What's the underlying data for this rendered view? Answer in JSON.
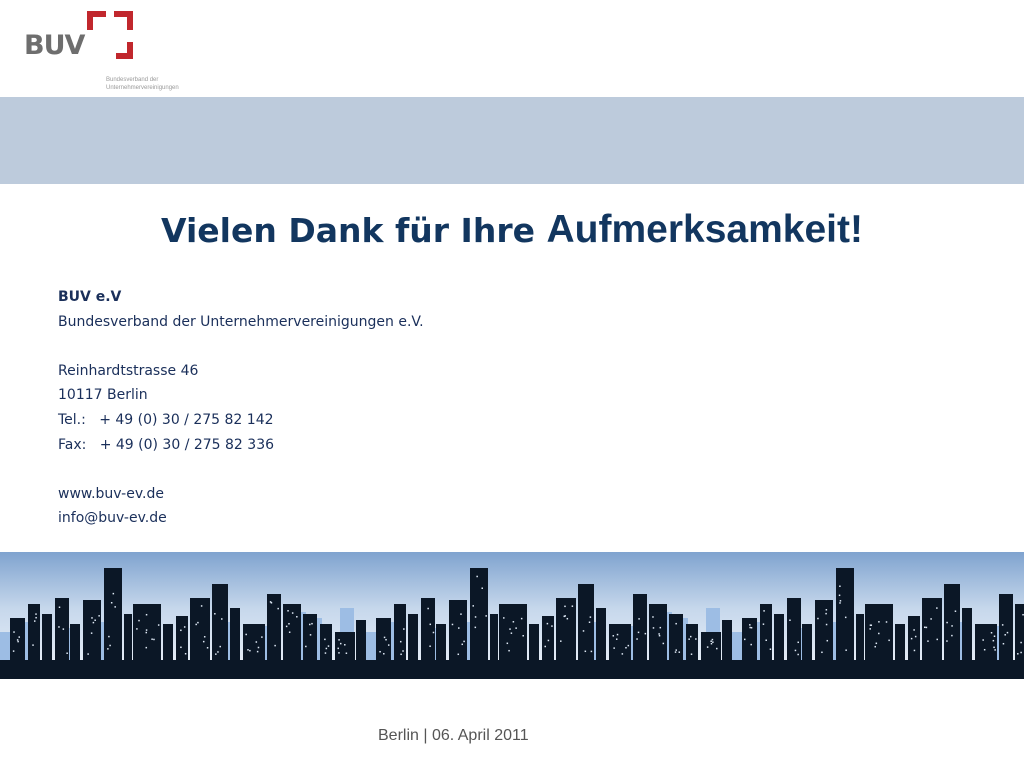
{
  "logo": {
    "word": "BUV",
    "subtitle_line1": "Bundesverband der",
    "subtitle_line2": "Unternehmervereinigungen"
  },
  "colors": {
    "bracket_red": "#c1272d",
    "band": "#bdcbdc",
    "title_blue": "#12365f",
    "text_blue": "#1a2f5a",
    "skyline_dark": "#0b1726",
    "skyline_light_building": "#9dbde4"
  },
  "title": {
    "part1": "Vielen Dank für Ihre ",
    "part2": "Aufmerksamkeit!"
  },
  "contact": {
    "org_short": "BUV e.V",
    "org_full": "Bundesverband der Unternehmervereinigungen e.V.",
    "street": "Reinhardtstrasse 46",
    "city": "10117 Berlin",
    "tel": "Tel.:   + 49 (0) 30 / 275 82 142",
    "fax": "Fax:   + 49 (0) 30 / 275 82 336",
    "web": "www.buv-ev.de",
    "email": "info@buv-ev.de"
  },
  "footer": {
    "text": "Berlin | 06. April 2011"
  }
}
